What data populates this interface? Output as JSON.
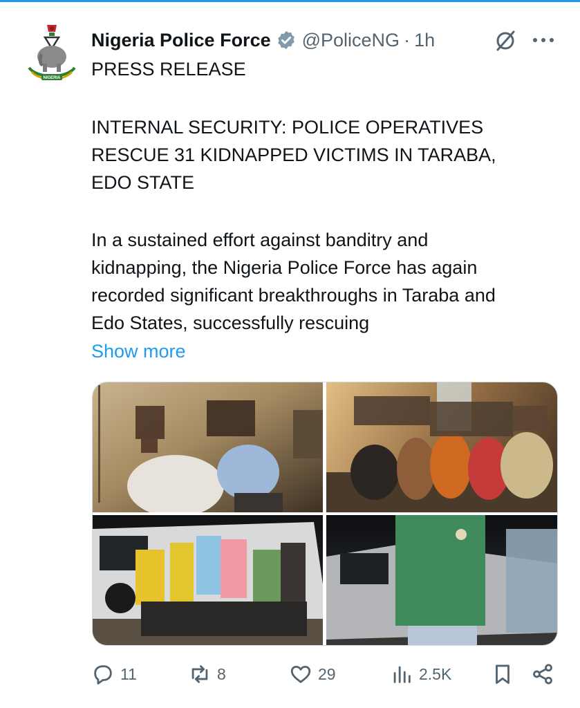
{
  "tweet": {
    "author_name": "Nigeria Police Force",
    "handle": "@PoliceNG",
    "separator": "·",
    "time": "1h",
    "lines_pr": [
      "PRESS RELEASE"
    ],
    "lines_title": [
      "INTERNAL SECURITY: POLICE OPERATIVES",
      "RESCUE 31 KIDNAPPED VICTIMS IN TARABA,",
      "EDO STATE"
    ],
    "lines_body": [
      "In a sustained effort against banditry and",
      "kidnapping, the Nigeria Police Force has again",
      "recorded significant breakthroughs in Taraba and",
      "Edo States, successfully rescuing"
    ],
    "show_more": "Show more"
  },
  "avatar": {
    "icon": "police-crest-logo",
    "emblem_text": "NIGERIA"
  },
  "media": {
    "photos": [
      {
        "label": "rescued victims indoors"
      },
      {
        "label": "rescued group seated in room"
      },
      {
        "label": "rescued group standing by vehicle at night"
      },
      {
        "label": "rescued person beside car at night"
      }
    ]
  },
  "actions": {
    "replies": "11",
    "reposts": "8",
    "likes": "29",
    "views": "2.5K"
  },
  "colors": {
    "accent": "#1d9bf0",
    "text": "#0f1419",
    "secondary": "#536471",
    "badge": "#829aab"
  }
}
